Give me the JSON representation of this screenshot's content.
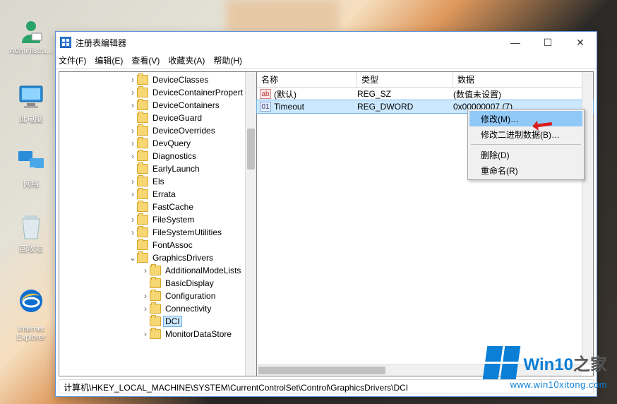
{
  "desktop_icons": [
    {
      "name": "admin",
      "label": "Administra..."
    },
    {
      "name": "thispc",
      "label": "此电脑"
    },
    {
      "name": "network",
      "label": "网络"
    },
    {
      "name": "recycle",
      "label": "回收站"
    },
    {
      "name": "ie",
      "label": "Internet\nExplorer"
    }
  ],
  "window": {
    "title": "注册表编辑器",
    "menu": [
      "文件(F)",
      "编辑(E)",
      "查看(V)",
      "收藏夹(A)",
      "帮助(H)"
    ],
    "columns": {
      "name": "名称",
      "type": "类型",
      "data": "数据"
    },
    "status": "计算机\\HKEY_LOCAL_MACHINE\\SYSTEM\\CurrentControlSet\\Control\\GraphicsDrivers\\DCI"
  },
  "tree": [
    {
      "indent": 1,
      "exp": ">",
      "label": "DeviceClasses"
    },
    {
      "indent": 1,
      "exp": ">",
      "label": "DeviceContainerPropert"
    },
    {
      "indent": 1,
      "exp": ">",
      "label": "DeviceContainers"
    },
    {
      "indent": 1,
      "exp": "",
      "label": "DeviceGuard"
    },
    {
      "indent": 1,
      "exp": ">",
      "label": "DeviceOverrides"
    },
    {
      "indent": 1,
      "exp": ">",
      "label": "DevQuery"
    },
    {
      "indent": 1,
      "exp": ">",
      "label": "Diagnostics"
    },
    {
      "indent": 1,
      "exp": "",
      "label": "EarlyLaunch"
    },
    {
      "indent": 1,
      "exp": ">",
      "label": "Els"
    },
    {
      "indent": 1,
      "exp": ">",
      "label": "Errata"
    },
    {
      "indent": 1,
      "exp": "",
      "label": "FastCache"
    },
    {
      "indent": 1,
      "exp": ">",
      "label": "FileSystem"
    },
    {
      "indent": 1,
      "exp": ">",
      "label": "FileSystemUtilities"
    },
    {
      "indent": 1,
      "exp": "",
      "label": "FontAssoc"
    },
    {
      "indent": 1,
      "exp": "v",
      "label": "GraphicsDrivers"
    },
    {
      "indent": 2,
      "exp": ">",
      "label": "AdditionalModeLists"
    },
    {
      "indent": 2,
      "exp": "",
      "label": "BasicDisplay"
    },
    {
      "indent": 2,
      "exp": ">",
      "label": "Configuration"
    },
    {
      "indent": 2,
      "exp": ">",
      "label": "Connectivity"
    },
    {
      "indent": 2,
      "exp": "",
      "label": "DCI",
      "sel": true
    },
    {
      "indent": 2,
      "exp": ">",
      "label": "MonitorDataStore"
    }
  ],
  "values": [
    {
      "kind": "sz",
      "name": "(默认)",
      "type": "REG_SZ",
      "data": "(数值未设置)"
    },
    {
      "kind": "dw",
      "name": "Timeout",
      "type": "REG_DWORD",
      "data": "0x00000007 (7)",
      "sel": true
    }
  ],
  "ctx": {
    "modify": "修改(M)…",
    "modify_bin": "修改二进制数据(B)…",
    "delete": "删除(D)",
    "rename": "重命名(R)"
  },
  "watermark": {
    "brand": "Win10",
    "sub": "之家",
    "url": "www.win10xitong.com"
  }
}
